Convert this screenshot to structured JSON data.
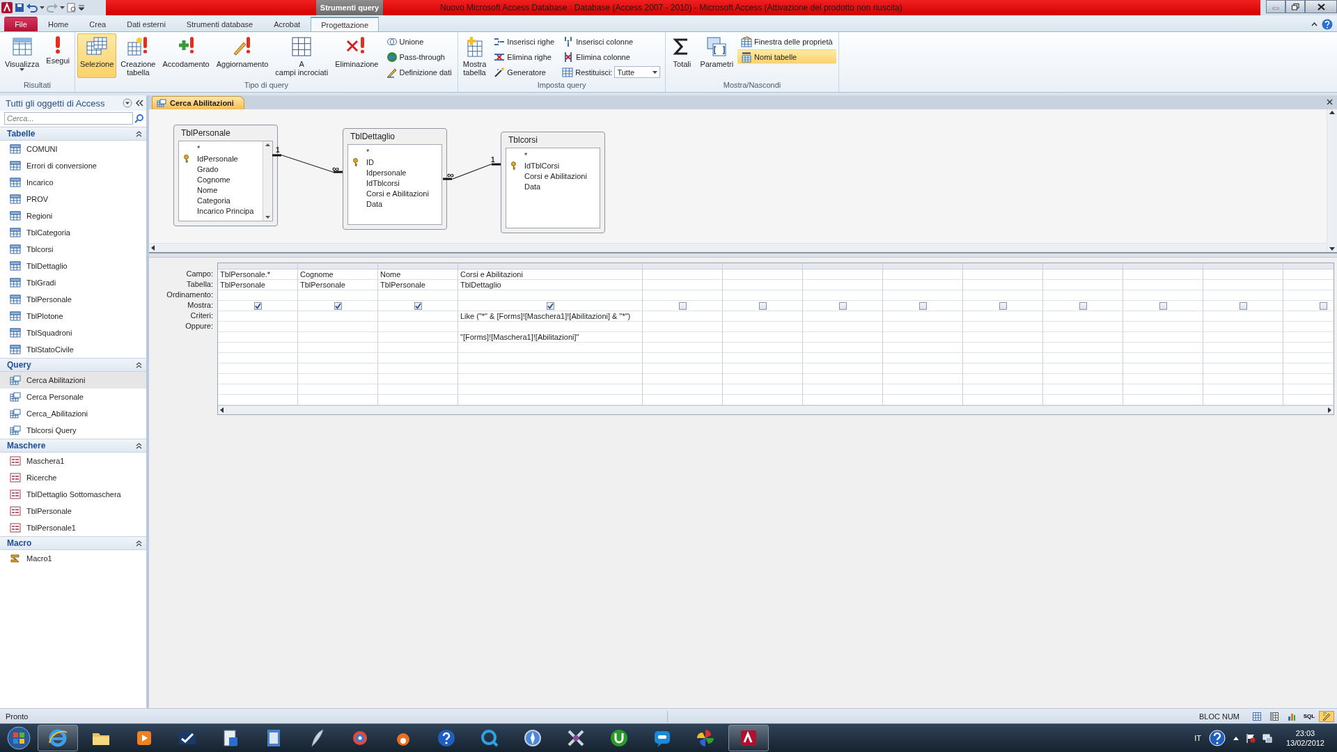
{
  "window": {
    "title": "Nuovo Microsoft Access Database : Database (Access 2007 - 2010)  -  Microsoft Access (Attivazione del prodotto non riuscita)",
    "context_group": "Strumenti query"
  },
  "ribbon_tabs": [
    {
      "label": "File",
      "kind": "file",
      "selected": false
    },
    {
      "label": "Home",
      "kind": "tab",
      "selected": false
    },
    {
      "label": "Crea",
      "kind": "tab",
      "selected": false
    },
    {
      "label": "Dati esterni",
      "kind": "tab",
      "selected": false
    },
    {
      "label": "Strumenti database",
      "kind": "tab",
      "selected": false
    },
    {
      "label": "Acrobat",
      "kind": "tab",
      "selected": false
    },
    {
      "label": "Progettazione",
      "kind": "tab",
      "selected": true
    }
  ],
  "ribbon": {
    "groups": [
      {
        "label": "Risultati",
        "items": [
          {
            "kind": "split",
            "label": "Visualizza",
            "selected": false
          },
          {
            "kind": "large",
            "label": "Esegui",
            "selected": false
          }
        ]
      },
      {
        "label": "Tipo di query",
        "items": [
          {
            "kind": "large",
            "label": "Selezione",
            "selected": true
          },
          {
            "kind": "large",
            "label": "Creazione tabella",
            "selected": false
          },
          {
            "kind": "large",
            "label": "Accodamento",
            "selected": false
          },
          {
            "kind": "large",
            "label": "Aggiornamento",
            "selected": false
          },
          {
            "kind": "large",
            "label": "A campi incrociati",
            "selected": false
          },
          {
            "kind": "large",
            "label": "Eliminazione",
            "selected": false
          },
          {
            "kind": "small",
            "label": "Unione",
            "selected": false
          },
          {
            "kind": "small",
            "label": "Pass-through",
            "selected": false
          },
          {
            "kind": "small",
            "label": "Definizione dati",
            "selected": false
          }
        ]
      },
      {
        "label": "Imposta query",
        "items": [
          {
            "kind": "large",
            "label": "Mostra tabella",
            "selected": false
          },
          {
            "kind": "small",
            "label": "Inserisci righe",
            "selected": false
          },
          {
            "kind": "small",
            "label": "Elimina righe",
            "selected": false
          },
          {
            "kind": "small",
            "label": "Generatore",
            "selected": false
          },
          {
            "kind": "small",
            "label": "Inserisci colonne",
            "selected": false
          },
          {
            "kind": "small",
            "label": "Elimina colonne",
            "selected": false
          },
          {
            "kind": "combo",
            "label": "Restituisci:",
            "value": "Tutte",
            "selected": false
          }
        ]
      },
      {
        "label": "Mostra/Nascondi",
        "items": [
          {
            "kind": "large",
            "label": "Totali",
            "selected": false
          },
          {
            "kind": "large",
            "label": "Parametri",
            "selected": false
          },
          {
            "kind": "small",
            "label": "Finestra delle proprietà",
            "selected": false
          },
          {
            "kind": "small",
            "label": "Nomi tabelle",
            "selected": true
          }
        ]
      }
    ]
  },
  "nav_pane": {
    "title": "Tutti gli oggetti di Access",
    "search": {
      "placeholder": "Cerca..."
    },
    "groups": [
      {
        "title": "Tabelle",
        "expanded": true,
        "items": [
          {
            "label": "COMUNI",
            "kind": "table",
            "selected": false
          },
          {
            "label": "Errori di conversione",
            "kind": "table",
            "selected": false
          },
          {
            "label": "Incarico",
            "kind": "table",
            "selected": false
          },
          {
            "label": "PROV",
            "kind": "table",
            "selected": false
          },
          {
            "label": "Regioni",
            "kind": "table",
            "selected": false
          },
          {
            "label": "TblCategoria",
            "kind": "table",
            "selected": false
          },
          {
            "label": "Tblcorsi",
            "kind": "table",
            "selected": false
          },
          {
            "label": "TblDettaglio",
            "kind": "table",
            "selected": false
          },
          {
            "label": "TblGradi",
            "kind": "table",
            "selected": false
          },
          {
            "label": "TblPersonale",
            "kind": "table",
            "selected": false
          },
          {
            "label": "TblPlotone",
            "kind": "table",
            "selected": false
          },
          {
            "label": "TblSquadroni",
            "kind": "table",
            "selected": false
          },
          {
            "label": "TblStatoCivile",
            "kind": "table",
            "selected": false
          }
        ]
      },
      {
        "title": "Query",
        "expanded": true,
        "items": [
          {
            "label": "Cerca Abilitazioni",
            "kind": "query",
            "selected": true
          },
          {
            "label": "Cerca Personale",
            "kind": "query",
            "selected": false
          },
          {
            "label": "Cerca_Abilitazioni",
            "kind": "query",
            "selected": false
          },
          {
            "label": "Tblcorsi Query",
            "kind": "query",
            "selected": false
          }
        ]
      },
      {
        "title": "Maschere",
        "expanded": true,
        "items": [
          {
            "label": "Maschera1",
            "kind": "form",
            "selected": false
          },
          {
            "label": "Ricerche",
            "kind": "form",
            "selected": false
          },
          {
            "label": "TblDettaglio Sottomaschera",
            "kind": "form",
            "selected": false
          },
          {
            "label": "TblPersonale",
            "kind": "form",
            "selected": false
          },
          {
            "label": "TblPersonale1",
            "kind": "form",
            "selected": false
          }
        ]
      },
      {
        "title": "Macro",
        "expanded": true,
        "items": [
          {
            "label": "Macro1",
            "kind": "macro",
            "selected": false
          }
        ]
      }
    ]
  },
  "document_tab": {
    "label": "Cerca Abilitazioni"
  },
  "query_tables": [
    {
      "name": "TblPersonale",
      "fields": [
        {
          "name": "*",
          "key": false
        },
        {
          "name": "IdPersonale",
          "key": true
        },
        {
          "name": "Grado",
          "key": false
        },
        {
          "name": "Cognome",
          "key": false
        },
        {
          "name": "Nome",
          "key": false
        },
        {
          "name": "Categoria",
          "key": false
        },
        {
          "name": "Incarico Principa",
          "key": false
        }
      ]
    },
    {
      "name": "TblDettaglio",
      "fields": [
        {
          "name": "*",
          "key": false
        },
        {
          "name": "ID",
          "key": true
        },
        {
          "name": "Idpersonale",
          "key": false
        },
        {
          "name": "IdTblcorsi",
          "key": false
        },
        {
          "name": "Corsi e Abilitazioni",
          "key": false
        },
        {
          "name": "Data",
          "key": false
        }
      ]
    },
    {
      "name": "Tblcorsi",
      "fields": [
        {
          "name": "*",
          "key": false
        },
        {
          "name": "IdTblCorsi",
          "key": true
        },
        {
          "name": "Corsi e Abilitazioni",
          "key": false
        },
        {
          "name": "Data",
          "key": false
        }
      ]
    }
  ],
  "joins": [
    {
      "from_mark": "1",
      "to_mark": "∞"
    },
    {
      "from_mark": "∞",
      "to_mark": "1"
    }
  ],
  "design_grid": {
    "row_labels": [
      "Campo:",
      "Tabella:",
      "Ordinamento:",
      "Mostra:",
      "Criteri:",
      "Oppure:"
    ],
    "columns": [
      {
        "field": "TblPersonale.*",
        "table": "TblPersonale",
        "show": true
      },
      {
        "field": "Cognome",
        "table": "TblPersonale",
        "show": true
      },
      {
        "field": "Nome",
        "table": "TblPersonale",
        "show": true
      },
      {
        "field": "Corsi e Abilitazioni",
        "table": "TblDettaglio",
        "show": true,
        "criteria": "Like (\"*\" & [Forms]![Maschera1]![Abilitazioni] & \"*\")",
        "extra_row": "\"[Forms]![Maschera1]![Abilitazioni]\""
      },
      {
        "show": false
      },
      {
        "show": false
      },
      {
        "show": false
      },
      {
        "show": false
      },
      {
        "show": false
      },
      {
        "show": false
      },
      {
        "show": false
      },
      {
        "show": false
      },
      {
        "show": false
      }
    ]
  },
  "status_bar": {
    "text": "Pronto",
    "indicator": "BLOC NUM",
    "views": [
      {
        "kind": "datasheet",
        "selected": false
      },
      {
        "kind": "pivottable",
        "selected": false
      },
      {
        "kind": "pivotchart",
        "selected": false
      },
      {
        "kind": "sql",
        "label": "SQL",
        "selected": false
      },
      {
        "kind": "design",
        "selected": true
      }
    ]
  },
  "taskbar": {
    "apps": [
      {
        "kind": "browser",
        "running": true
      },
      {
        "kind": "folder",
        "running": false
      },
      {
        "kind": "media",
        "running": false
      },
      {
        "kind": "wave",
        "running": false
      },
      {
        "kind": "installer",
        "running": false
      },
      {
        "kind": "notes",
        "running": false
      },
      {
        "kind": "feather",
        "running": false
      },
      {
        "kind": "network",
        "running": false
      },
      {
        "kind": "paw",
        "running": false
      },
      {
        "kind": "help",
        "running": false
      },
      {
        "kind": "search",
        "running": false
      },
      {
        "kind": "compass",
        "running": false
      },
      {
        "kind": "cross",
        "running": false
      },
      {
        "kind": "torrent",
        "running": false
      },
      {
        "kind": "chat",
        "running": false
      },
      {
        "kind": "pinwheel",
        "running": false
      },
      {
        "kind": "database",
        "running": true
      }
    ],
    "language": "IT",
    "time": "23:03",
    "date": "13/02/2012"
  }
}
